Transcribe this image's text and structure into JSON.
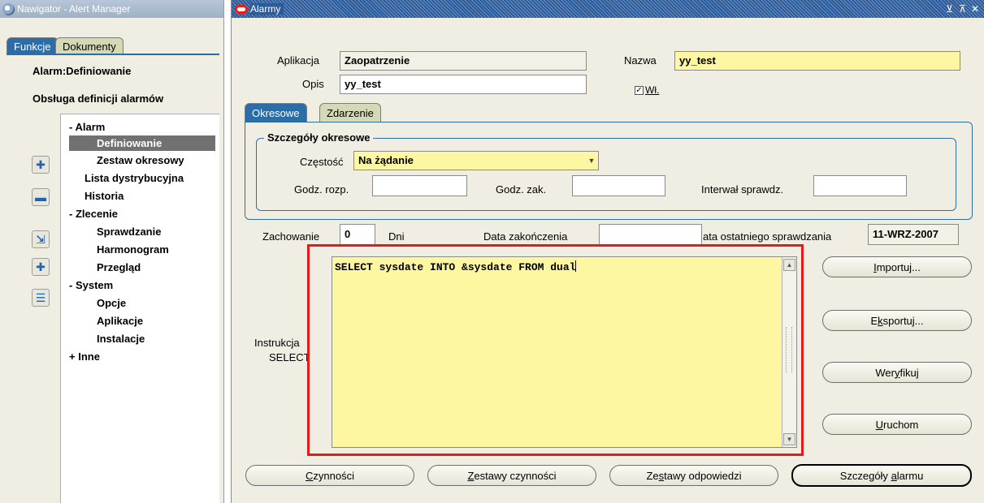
{
  "navigator": {
    "title": "Nawigator - Alert Manager",
    "tabs": [
      "Funkcje",
      "Dokumenty"
    ],
    "heading": "Alarm:Definiowanie",
    "subheading": "Obsługa definicji alarmów",
    "tree": [
      {
        "prefix": "-",
        "label": "Alarm"
      },
      {
        "prefix": "",
        "label": "Definiowanie",
        "selected": true
      },
      {
        "prefix": "",
        "label": "Zestaw okresowy"
      },
      {
        "prefix": "",
        "label": "Lista dystrybucyjna"
      },
      {
        "prefix": "",
        "label": "Historia"
      },
      {
        "prefix": "-",
        "label": "Zlecenie"
      },
      {
        "prefix": "",
        "label": "Sprawdzanie"
      },
      {
        "prefix": "",
        "label": "Harmonogram"
      },
      {
        "prefix": "",
        "label": "Przegląd"
      },
      {
        "prefix": "-",
        "label": "System"
      },
      {
        "prefix": "",
        "label": "Opcje"
      },
      {
        "prefix": "",
        "label": "Aplikacje"
      },
      {
        "prefix": "",
        "label": "Instalacje"
      },
      {
        "prefix": "+",
        "label": "Inne"
      }
    ]
  },
  "alarm_window": {
    "title": "Alarmy",
    "aplikacja_label": "Aplikacja",
    "aplikacja_value": "Zaopatrzenie",
    "nazwa_label": "Nazwa",
    "nazwa_value": "yy_test",
    "opis_label": "Opis",
    "opis_value": "yy_test",
    "wl_label": "Wł.",
    "tabs": [
      "Okresowe",
      "Zdarzenie"
    ],
    "group_title": "Szczegóły okresowe",
    "czestosc_label": "Częstość",
    "czestosc_value": "Na żądanie",
    "godz_rozp_label": "Godz. rozp.",
    "godz_zak_label": "Godz. zak.",
    "interwal_label": "Interwał sprawdz.",
    "zachowanie_label": "Zachowanie",
    "zachowanie_value": "0",
    "dni_label": "Dni",
    "data_zak_label": "Data zakończenia",
    "data_ost_label": "ata ostatniego sprawdzania",
    "data_ost_value": "11-WRZ-2007",
    "instrukcja_label_1": "Instrukcja",
    "instrukcja_label_2": "SELECT",
    "sql_text": "SELECT sysdate INTO &sysdate FROM dual",
    "side_buttons": {
      "importuj": {
        "pre": "",
        "u": "I",
        "post": "mportuj..."
      },
      "eksportuj": {
        "pre": "E",
        "u": "k",
        "post": "sportuj..."
      },
      "weryfikuj": {
        "pre": "Wer",
        "u": "y",
        "post": "fikuj"
      },
      "uruchom": {
        "pre": "",
        "u": "U",
        "post": "ruchom"
      }
    },
    "bottom_buttons": {
      "czynnosci": {
        "pre": "",
        "u": "C",
        "post": "zynności"
      },
      "zestawy_czynnosci": {
        "pre": "",
        "u": "Z",
        "post": "estawy czynności"
      },
      "zestawy_odpowiedzi": {
        "pre": "Ze",
        "u": "s",
        "post": "tawy odpowiedzi"
      },
      "szczegoly_alarmu": {
        "pre": "Szczegóły ",
        "u": "a",
        "post": "larmu"
      }
    }
  },
  "colors": {
    "tab_active": "#2d6da7",
    "tab_inactive": "#d5d9b6",
    "required_field": "#fdf7a2",
    "selected_tree_item": "#717171",
    "highlight_box": "#e31b1b"
  }
}
